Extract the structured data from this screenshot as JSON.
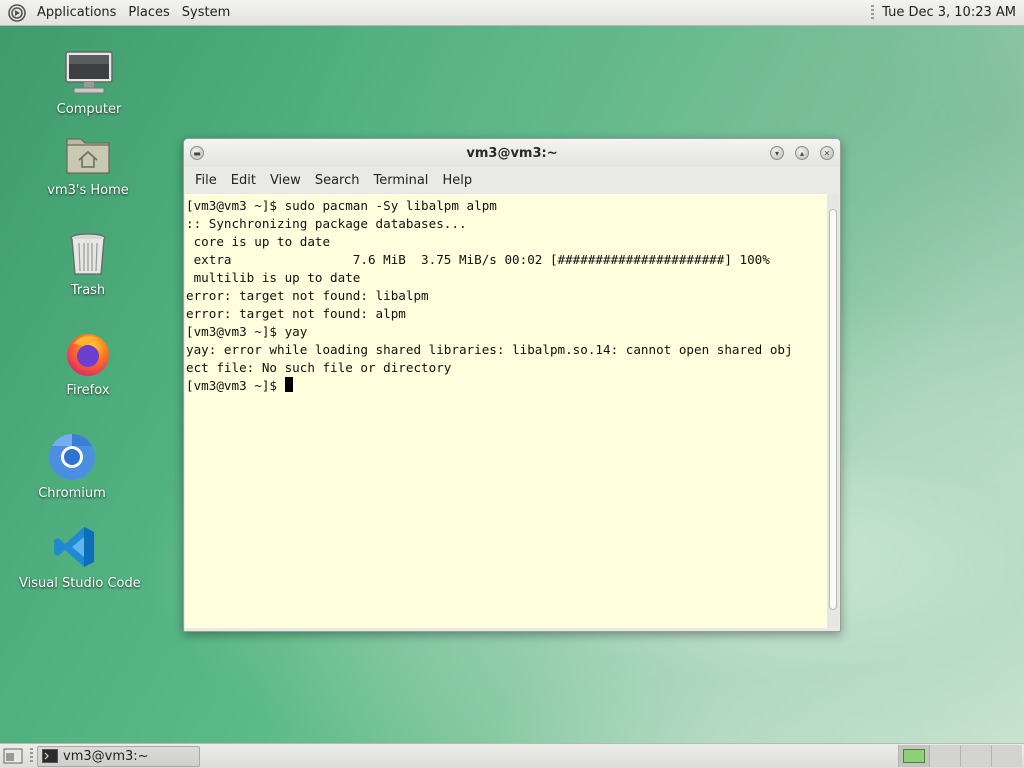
{
  "top_panel": {
    "menus": [
      "Applications",
      "Places",
      "System"
    ],
    "clock": "Tue Dec  3, 10:23 AM"
  },
  "desktop_icons": [
    {
      "label": "Computer",
      "icon": "computer-icon"
    },
    {
      "label": "vm3's Home",
      "icon": "home-folder-icon"
    },
    {
      "label": "Trash",
      "icon": "trash-icon"
    },
    {
      "label": "Firefox",
      "icon": "firefox-icon"
    },
    {
      "label": "Chromium",
      "icon": "chromium-icon"
    },
    {
      "label": "Visual Studio Code",
      "icon": "vscode-icon"
    }
  ],
  "window": {
    "title": "vm3@vm3:~",
    "menus": [
      "File",
      "Edit",
      "View",
      "Search",
      "Terminal",
      "Help"
    ],
    "lines": [
      "[vm3@vm3 ~]$ sudo pacman -Sy libalpm alpm",
      ":: Synchronizing package databases...",
      " core is up to date",
      " extra                7.6 MiB  3.75 MiB/s 00:02 [######################] 100%",
      " multilib is up to date",
      "error: target not found: libalpm",
      "error: target not found: alpm",
      "[vm3@vm3 ~]$ yay",
      "yay: error while loading shared libraries: libalpm.so.14: cannot open shared obj",
      "ect file: No such file or directory",
      "[vm3@vm3 ~]$ "
    ],
    "background": "#ffffdd"
  },
  "taskbar": {
    "task_label": "vm3@vm3:~"
  }
}
